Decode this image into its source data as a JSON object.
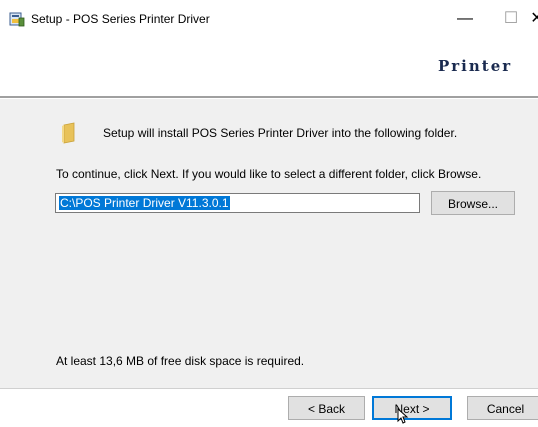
{
  "window": {
    "title": "Setup - POS Series Printer Driver",
    "min_glyph": "—",
    "max_glyph": "☐",
    "close_glyph": "✕"
  },
  "header": {
    "brand_text": "Printer"
  },
  "content": {
    "install_text": "Setup will install POS Series Printer Driver into the following folder.",
    "continue_text": "To continue, click Next. If you would like to select a different folder, click Browse.",
    "path_value": "C:\\POS Printer Driver V11.3.0.1",
    "browse_label": "Browse...",
    "space_text": "At least 13,6 MB of free disk space is required."
  },
  "footer": {
    "back_label": "< Back",
    "next_label": "Next >",
    "cancel_label": "Cancel"
  },
  "colors": {
    "accent": "#0078d7",
    "folder": "#e8c25a"
  }
}
